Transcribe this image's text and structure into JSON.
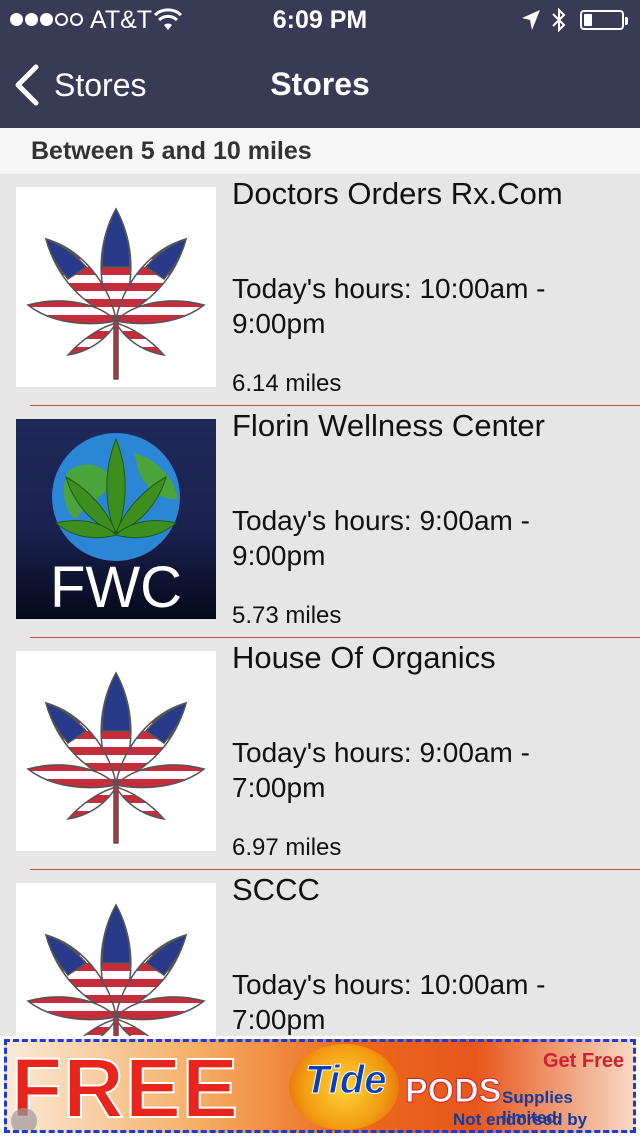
{
  "status_bar": {
    "carrier": "AT&T",
    "time": "6:09 PM",
    "signal_bars_filled": 3,
    "signal_bars_total": 5
  },
  "nav": {
    "back_label": "Stores",
    "title": "Stores"
  },
  "section": {
    "header": "Between 5 and 10 miles"
  },
  "stores": [
    {
      "name": "Doctors Orders Rx.Com",
      "hours": "Today's hours: 10:00am - 9:00pm",
      "distance": "6.14 miles",
      "logo": "flag-leaf"
    },
    {
      "name": "Florin Wellness Center",
      "hours": "Today's hours: 9:00am - 9:00pm",
      "distance": "5.73 miles",
      "logo": "fwc-globe",
      "logo_text": "FWC"
    },
    {
      "name": "House Of Organics",
      "hours": "Today's hours: 9:00am - 7:00pm",
      "distance": "6.97 miles",
      "logo": "flag-leaf"
    },
    {
      "name": "SCCC",
      "hours": "Today's hours: 10:00am - 7:00pm",
      "distance": "",
      "logo": "flag-leaf"
    }
  ],
  "ad": {
    "free": "FREE",
    "brand": "Tide",
    "product": "PODS",
    "cta": "Get Free",
    "line1": "Supplies limited.",
    "line2": "Not endorsed by P&G."
  },
  "colors": {
    "nav_bg": "#393a55",
    "separator": "#c24a4a",
    "list_bg": "#e6e6e6"
  }
}
